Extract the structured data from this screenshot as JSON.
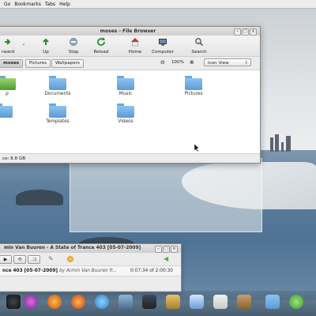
{
  "menubar": {
    "items": [
      "Go",
      "Bookmarks",
      "Tabs",
      "Help"
    ]
  },
  "file_browser": {
    "title": "moses - File Browser",
    "toolbar": {
      "forward": "rward",
      "up": "Up",
      "stop": "Stop",
      "reload": "Reload",
      "home": "Home",
      "computer": "Computer",
      "search": "Search"
    },
    "path": {
      "crumbs": [
        "moses",
        "Pictures",
        "Wallpapers"
      ]
    },
    "zoom": "100%",
    "view_mode": "Icon View",
    "folders_row1": [
      "p",
      "Documents",
      "Music",
      "Pictures"
    ],
    "folders_row2": [
      "",
      "Templates",
      "Videos"
    ],
    "status": "ce: 8.8 GB"
  },
  "media_player": {
    "title": "min Van Buuren - A State of Trance 403 [05-07-2009]",
    "track_title": "nce 403 [05-07-2009]",
    "track_artist": "by Armin Van Buuren fr...",
    "time": "0:07:34 of 2:00:30"
  },
  "colors": {
    "folder_blue": "#5b9bd6",
    "accent_green": "#4caf50"
  }
}
